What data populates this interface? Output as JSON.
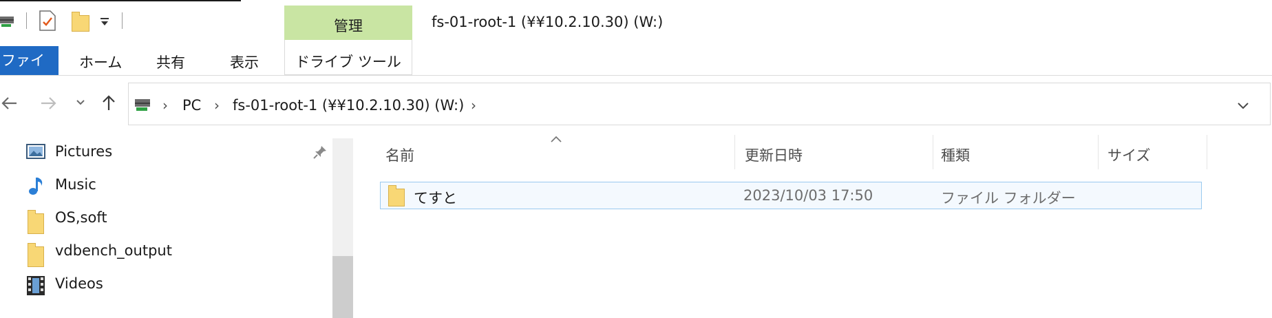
{
  "window": {
    "context_group": "管理",
    "title": "fs-01-root-1 (¥¥10.2.10.30) (W:)"
  },
  "ribbon": {
    "tabs": [
      "ファイル",
      "ホーム",
      "共有",
      "表示"
    ],
    "context_tab": "ドライブ ツール",
    "accent_color": "#1f6ac4",
    "context_color": "#c9e5a3"
  },
  "address": {
    "segments": [
      "PC",
      "fs-01-root-1 (¥¥10.2.10.30) (W:)"
    ]
  },
  "nav": {
    "items": [
      {
        "label": "Pictures",
        "icon": "pictures-icon"
      },
      {
        "label": "Music",
        "icon": "music-icon"
      },
      {
        "label": "OS,soft",
        "icon": "folder-icon"
      },
      {
        "label": "vdbench_output",
        "icon": "folder-icon"
      },
      {
        "label": "Videos",
        "icon": "videos-icon"
      }
    ]
  },
  "list": {
    "columns": [
      "名前",
      "更新日時",
      "種類",
      "サイズ"
    ],
    "rows": [
      {
        "name": "てすと",
        "modified": "2023/10/03 17:50",
        "type": "ファイル フォルダー",
        "size": ""
      }
    ]
  }
}
